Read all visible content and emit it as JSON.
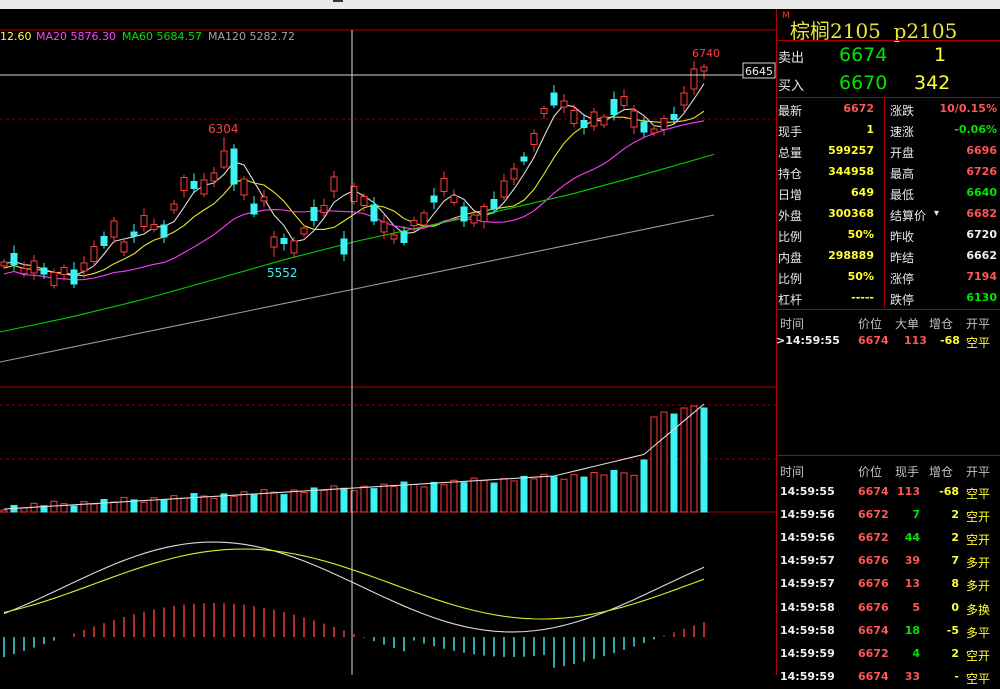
{
  "ma_legend": [
    {
      "label": "12.60",
      "color": "#ffff40"
    },
    {
      "label": "MA20 5876.30",
      "color": "#ff40ff"
    },
    {
      "label": "MA60 5684.57",
      "color": "#00e000"
    },
    {
      "label": "MA120 5282.72",
      "color": "#a0a0a0"
    }
  ],
  "price_marks": {
    "high": "6740",
    "mid_high": "6304",
    "low": "5552",
    "cursor": "6645"
  },
  "instrument": {
    "name": "棕榈2105",
    "code": "p2105",
    "marker": "M"
  },
  "quote": {
    "ask_label": "卖出",
    "ask_price": "6674",
    "ask_vol": "1",
    "bid_label": "买入",
    "bid_price": "6670",
    "bid_vol": "342"
  },
  "stats_left": [
    {
      "label": "最新",
      "value": "6672",
      "color": "red"
    },
    {
      "label": "现手",
      "value": "1",
      "color": "yel"
    },
    {
      "label": "总量",
      "value": "599257",
      "color": "yel"
    },
    {
      "label": "持仓",
      "value": "344958",
      "color": "yel"
    },
    {
      "label": "日增",
      "value": "649",
      "color": "yel"
    },
    {
      "label": "外盘",
      "value": "300368",
      "color": "yel"
    },
    {
      "label": "比例",
      "value": "50%",
      "color": "yel"
    },
    {
      "label": "内盘",
      "value": "298889",
      "color": "yel"
    },
    {
      "label": "比例",
      "value": "50%",
      "color": "yel"
    },
    {
      "label": "杠杆",
      "value": "-----",
      "color": "yel"
    }
  ],
  "stats_right": [
    {
      "label": "涨跌",
      "value": "10/0.15%",
      "color": "red"
    },
    {
      "label": "速涨",
      "value": "-0.06%",
      "color": "grn"
    },
    {
      "label": "开盘",
      "value": "6696",
      "color": "red"
    },
    {
      "label": "最高",
      "value": "6726",
      "color": "red"
    },
    {
      "label": "最低",
      "value": "6640",
      "color": "grn"
    },
    {
      "label": "结算价",
      "value": "6682",
      "color": "red"
    },
    {
      "label": "昨收",
      "value": "6720",
      "color": "wht"
    },
    {
      "label": "昨结",
      "value": "6662",
      "color": "wht"
    },
    {
      "label": "涨停",
      "value": "7194",
      "color": "red"
    },
    {
      "label": "跌停",
      "value": "6130",
      "color": "grn"
    }
  ],
  "big_order_header": {
    "c1": "时间",
    "c2": "价位",
    "c3": "大单",
    "c4": "增仓",
    "c5": "开平"
  },
  "big_orders": [
    {
      "time": ">14:59:55",
      "price": "6674",
      "vol": "113",
      "chg": "-68",
      "type": "空平"
    }
  ],
  "ticks_header": {
    "c1": "时间",
    "c2": "价位",
    "c3": "现手",
    "c4": "增仓",
    "c5": "开平"
  },
  "ticks": [
    {
      "time": "14:59:55",
      "price": "6674",
      "vol": "113",
      "chg": "-68",
      "type": "空平",
      "pc": "red",
      "vc": "red",
      "cc": "yel"
    },
    {
      "time": "14:59:56",
      "price": "6672",
      "vol": "7",
      "chg": "2",
      "type": "空开",
      "pc": "red",
      "vc": "grn",
      "cc": "yel"
    },
    {
      "time": "14:59:56",
      "price": "6672",
      "vol": "44",
      "chg": "2",
      "type": "空开",
      "pc": "red",
      "vc": "grn",
      "cc": "yel"
    },
    {
      "time": "14:59:57",
      "price": "6676",
      "vol": "39",
      "chg": "7",
      "type": "多开",
      "pc": "red",
      "vc": "red",
      "cc": "yel"
    },
    {
      "time": "14:59:57",
      "price": "6676",
      "vol": "13",
      "chg": "8",
      "type": "多开",
      "pc": "red",
      "vc": "red",
      "cc": "yel"
    },
    {
      "time": "14:59:58",
      "price": "6676",
      "vol": "5",
      "chg": "0",
      "type": "多换",
      "pc": "red",
      "vc": "red",
      "cc": "yel"
    },
    {
      "time": "14:59:58",
      "price": "6674",
      "vol": "18",
      "chg": "-5",
      "type": "多平",
      "pc": "red",
      "vc": "grn",
      "cc": "yel"
    },
    {
      "time": "14:59:59",
      "price": "6672",
      "vol": "4",
      "chg": "2",
      "type": "空开",
      "pc": "red",
      "vc": "grn",
      "cc": "yel"
    },
    {
      "time": "14:59:59",
      "price": "6674",
      "vol": "33",
      "chg": "-",
      "type": "空平",
      "pc": "red",
      "vc": "red",
      "cc": "yel"
    }
  ]
}
